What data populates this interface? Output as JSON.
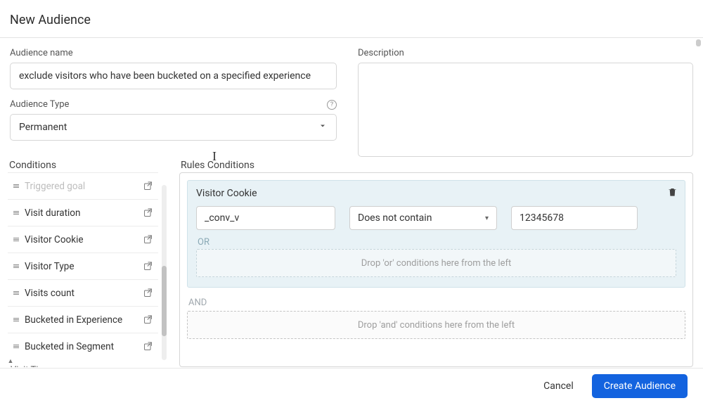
{
  "page_title": "New Audience",
  "fields": {
    "audience_name_label": "Audience name",
    "audience_name_value": "exclude visitors who have been bucketed on a specified experience",
    "audience_type_label": "Audience Type",
    "audience_type_value": "Permanent",
    "description_label": "Description",
    "description_value": ""
  },
  "conditions": {
    "section_title": "Conditions",
    "group_visit_time": "Visit Time",
    "items": [
      {
        "label": "Triggered goal",
        "faded": true
      },
      {
        "label": "Visit duration",
        "faded": false
      },
      {
        "label": "Visitor Cookie",
        "faded": false
      },
      {
        "label": "Visitor Type",
        "faded": false
      },
      {
        "label": "Visits count",
        "faded": false
      },
      {
        "label": "Bucketed in Experience",
        "faded": false
      },
      {
        "label": "Bucketed in Segment",
        "faded": false
      }
    ]
  },
  "rules": {
    "section_title": "Rules Conditions",
    "card_title": "Visitor Cookie",
    "cookie_name": "_conv_v",
    "operator": "Does not contain",
    "value": "12345678",
    "or_label": "OR",
    "and_label": "AND",
    "or_dropzone": "Drop 'or' conditions here from the left",
    "and_dropzone": "Drop 'and' conditions here from the left"
  },
  "footer": {
    "cancel": "Cancel",
    "create": "Create Audience"
  }
}
